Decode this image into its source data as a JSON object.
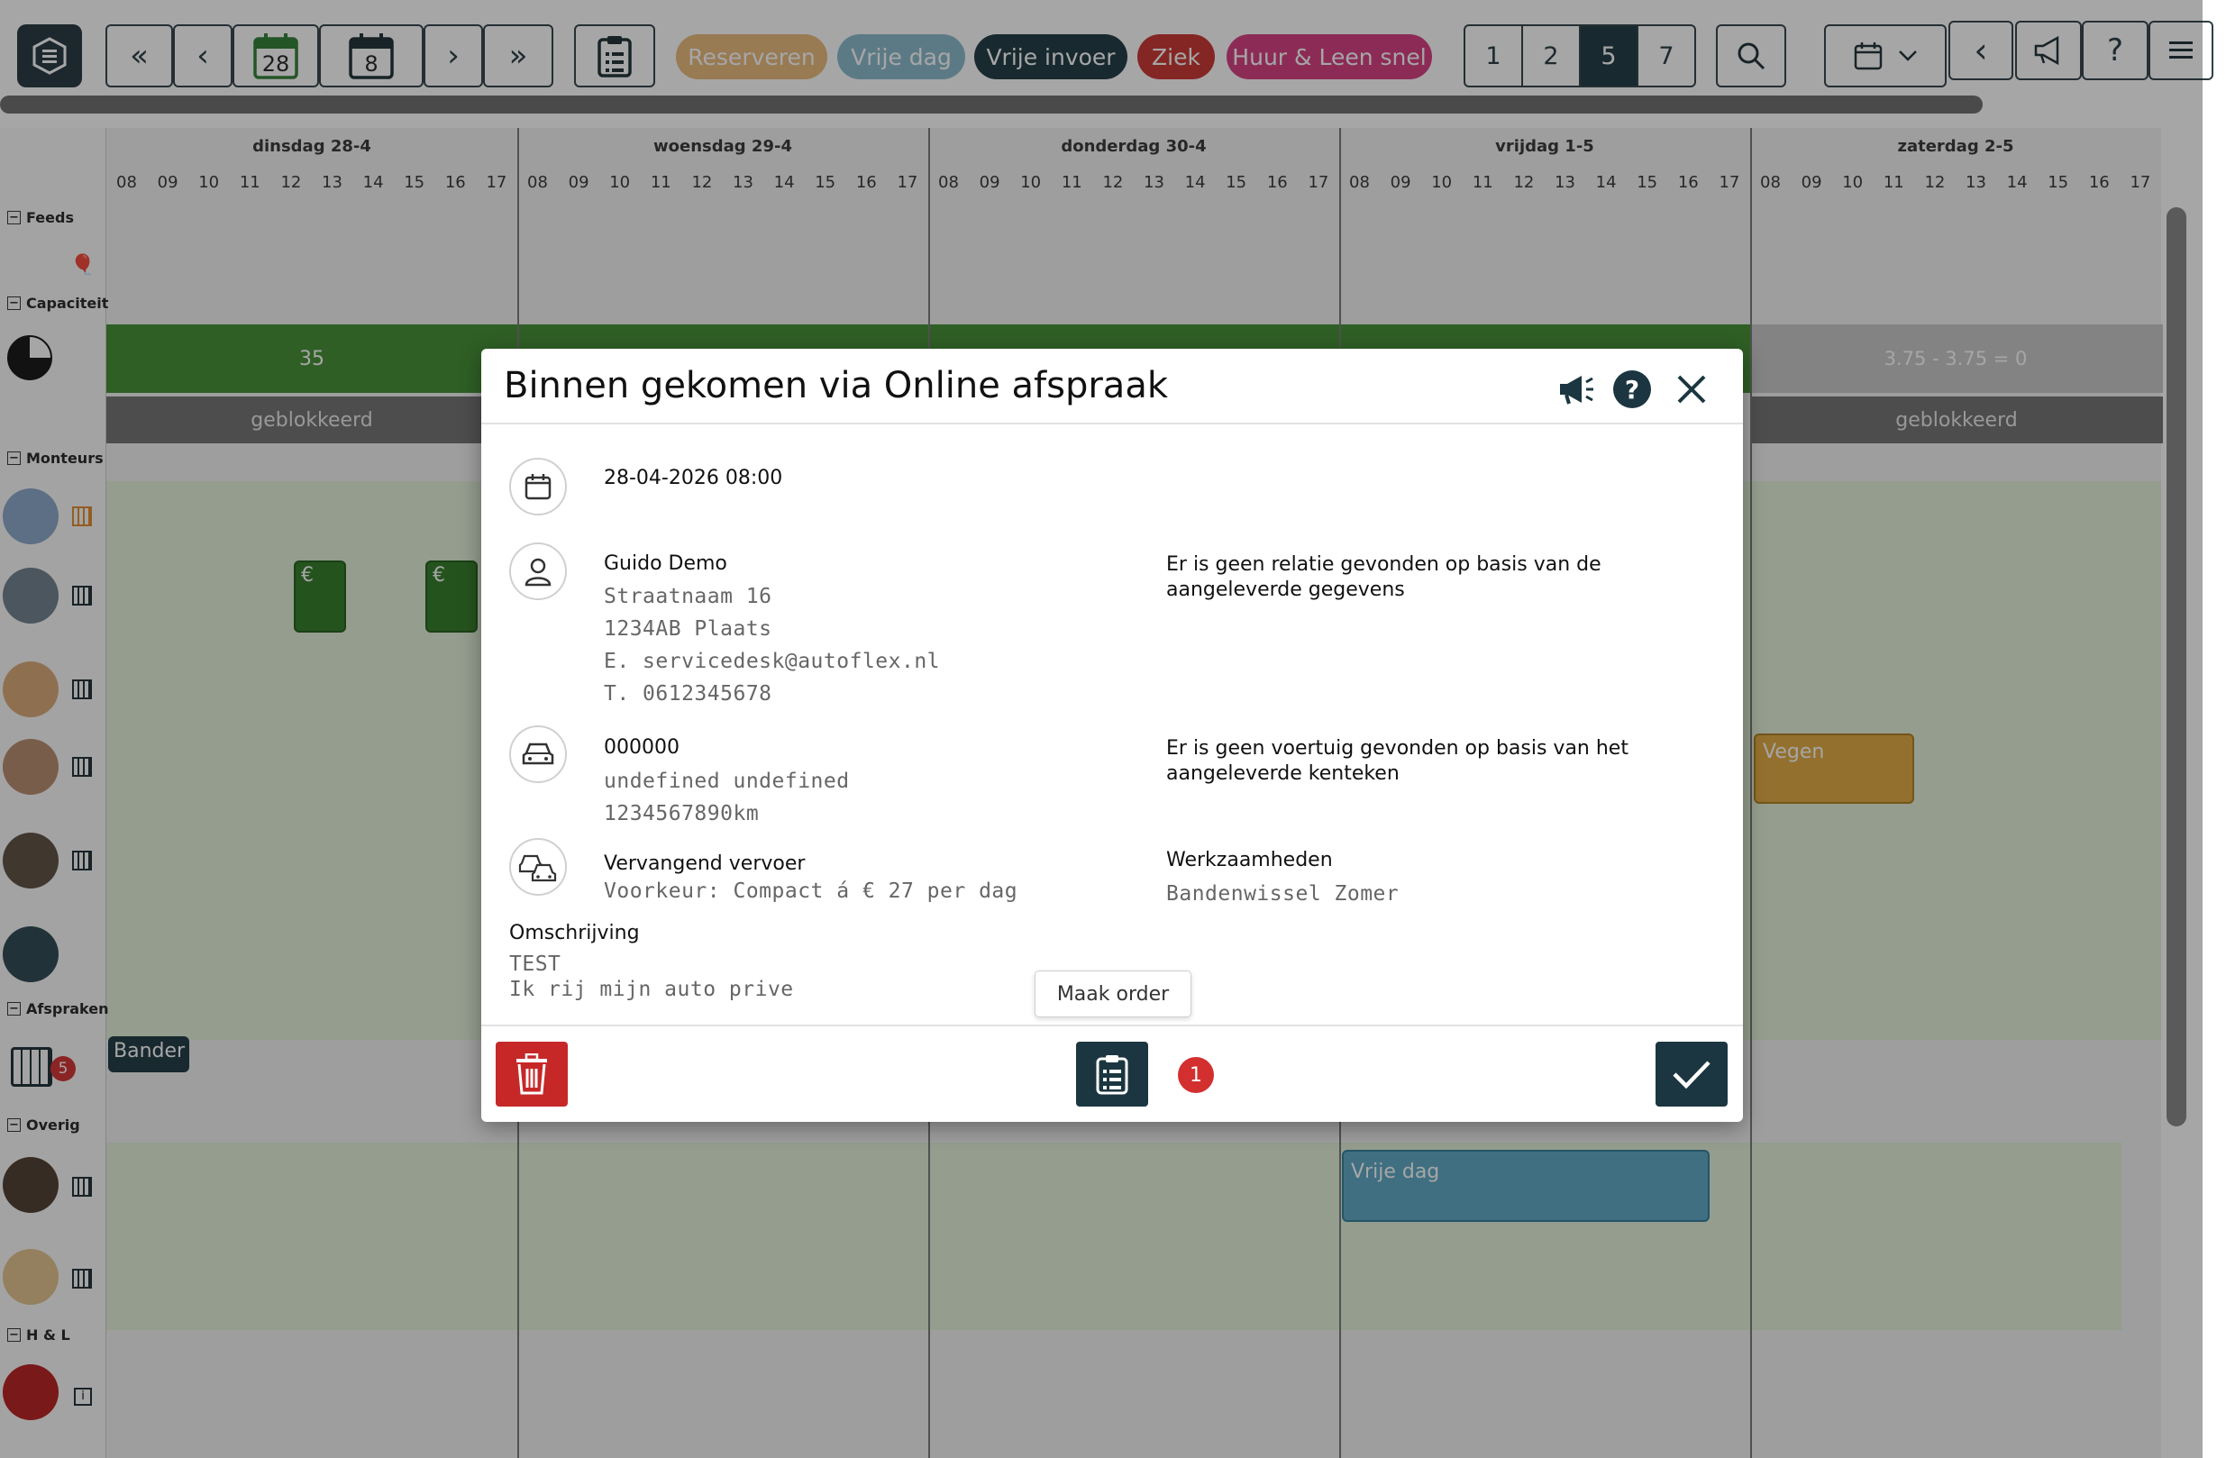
{
  "toolbar": {
    "date_today_day": "28",
    "date_week": "8",
    "pills": [
      {
        "label": "Reserveren",
        "bg": "#e8b97a",
        "fg": "#ffffff"
      },
      {
        "label": "Vrije dag",
        "bg": "#86b9cc",
        "fg": "#ffffff"
      },
      {
        "label": "Vrije invoer",
        "bg": "#1b3640",
        "fg": "#ffffff"
      },
      {
        "label": "Ziek",
        "bg": "#c8322e",
        "fg": "#ffffff"
      },
      {
        "label": "Huur & Leen snel",
        "bg": "#d63a7e",
        "fg": "#ffffff"
      }
    ],
    "day_counts": [
      "1",
      "2",
      "5",
      "7"
    ],
    "active_day_count": "5"
  },
  "days": [
    {
      "label": "dinsdag 28-4"
    },
    {
      "label": "woensdag 29-4"
    },
    {
      "label": "donderdag 30-4"
    },
    {
      "label": "vrijdag 1-5"
    },
    {
      "label": "zaterdag 2-5"
    }
  ],
  "hours": [
    "08",
    "09",
    "10",
    "11",
    "12",
    "13",
    "14",
    "15",
    "16",
    "17"
  ],
  "sections": {
    "feeds": "Feeds",
    "capacity": "Capaciteit",
    "mechanics": "Monteurs",
    "appointments": "Afspraken",
    "other": "Overig",
    "hl": "H & L"
  },
  "capacity": {
    "tuesday_value": "35",
    "saturday_value": "3.75 - 3.75 = 0",
    "blocked_label": "geblokkeerd"
  },
  "events": {
    "appointment_label": "Bander",
    "appointment_badge": "5",
    "sweep_label": "Vegen",
    "free_day_label": "Vrije dag",
    "euro_symbol": "€"
  },
  "modal": {
    "title": "Binnen gekomen via Online afspraak",
    "datetime": "28-04-2026 08:00",
    "customer": {
      "name": "Guido Demo",
      "street": "Straatnaam 16",
      "postal": "1234AB Plaats",
      "email": "E. servicedesk@autoflex.nl",
      "phone": "T. 0612345678",
      "no_relation": "Er is geen relatie gevonden op basis van de aangeleverde gegevens"
    },
    "vehicle": {
      "plate": "000000",
      "model": "undefined undefined",
      "mileage": "1234567890km",
      "no_vehicle": "Er is geen voertuig gevonden op basis van het aangeleverde kenteken"
    },
    "replacement": {
      "label": "Vervangend vervoer",
      "preference": "Voorkeur: Compact á € 27 per dag"
    },
    "work": {
      "label": "Werkzaamheden",
      "value": "Bandenwissel Zomer"
    },
    "description": {
      "label": "Omschrijving",
      "line1": "TEST",
      "line2": "Ik rij mijn auto prive"
    },
    "tooltip": "Maak order",
    "order_badge": "1"
  }
}
